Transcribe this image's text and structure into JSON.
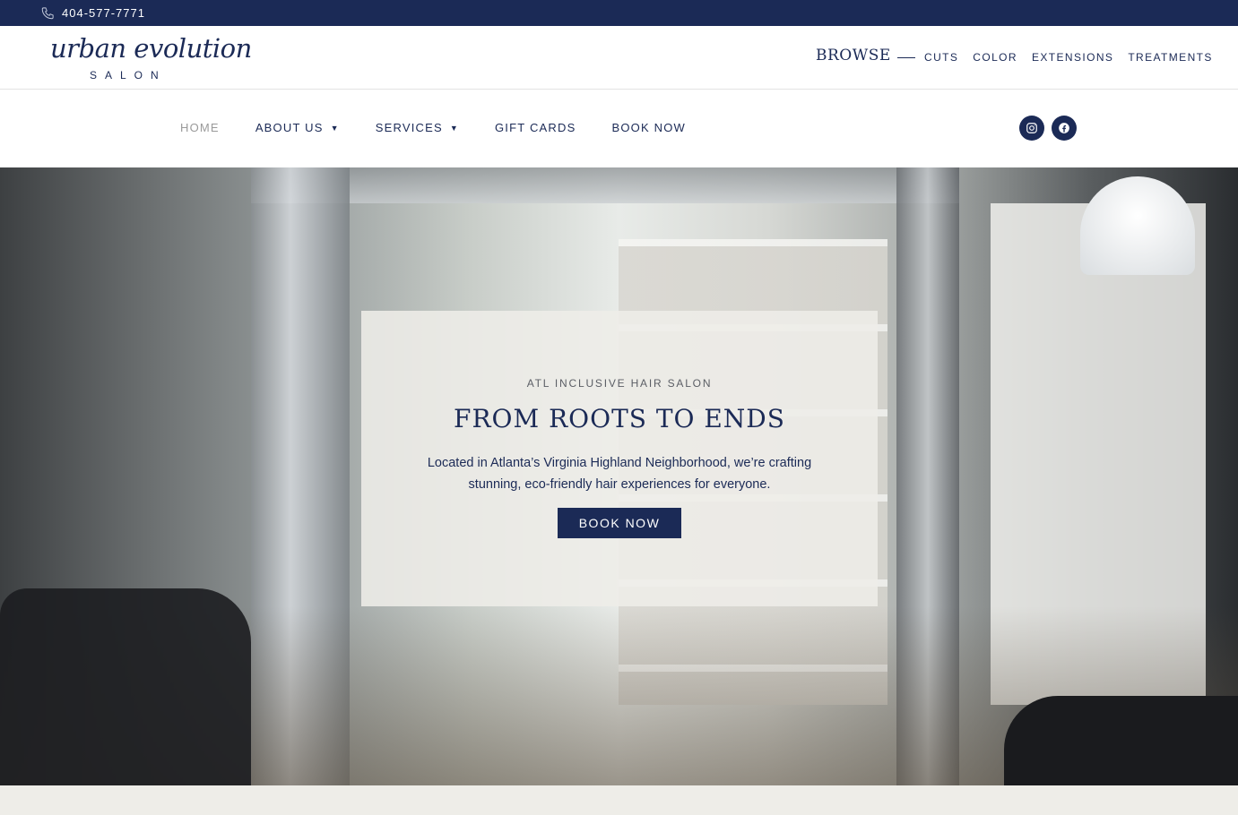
{
  "topbar": {
    "phone": "404-577-7771",
    "icon": "phone-icon"
  },
  "brand": {
    "script": "urban evolution",
    "sub": "SALON"
  },
  "browse": {
    "label": "BROWSE",
    "links": [
      "CUTS",
      "COLOR",
      "EXTENSIONS",
      "TREATMENTS"
    ]
  },
  "nav": {
    "items": [
      {
        "label": "HOME",
        "dropdown": false,
        "active": true
      },
      {
        "label": "ABOUT US",
        "dropdown": true
      },
      {
        "label": "SERVICES",
        "dropdown": true
      },
      {
        "label": "GIFT CARDS",
        "dropdown": false
      },
      {
        "label": "BOOK NOW",
        "dropdown": false
      }
    ],
    "socials": [
      "instagram-icon",
      "facebook-icon"
    ]
  },
  "hero": {
    "eyebrow": "ATL INCLUSIVE HAIR SALON",
    "title": "FROM ROOTS TO ENDS",
    "description": "Located in Atlanta’s Virginia Highland Neighborhood, we’re crafting stunning, eco-friendly hair experiences for everyone.",
    "cta": "BOOK NOW"
  },
  "colors": {
    "navy": "#1b2a56",
    "muted": "#9a9a9a",
    "card": "#eeede8"
  }
}
